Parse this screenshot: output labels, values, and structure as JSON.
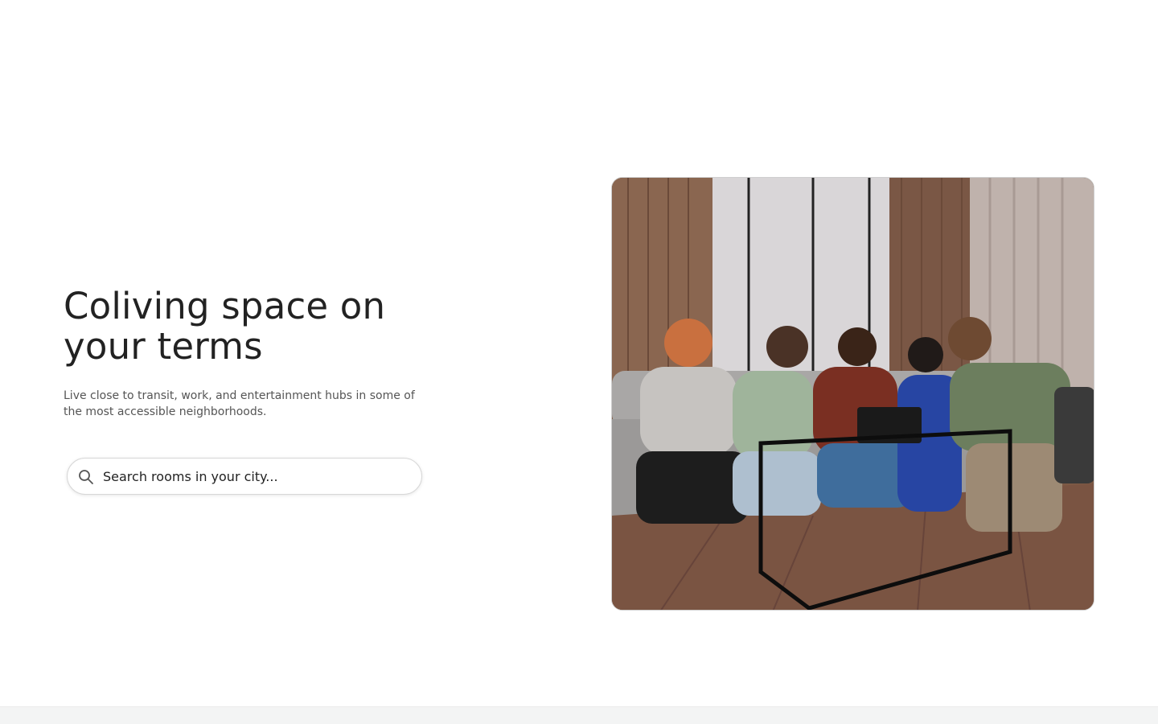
{
  "hero": {
    "title": "Coliving space on your terms",
    "subtitle": "Live close to transit, work, and entertainment hubs in some of the most accessible neighborhoods."
  },
  "search": {
    "placeholder": "Search rooms in your city...",
    "icon": "search-icon"
  },
  "colors": {
    "text": "#222222",
    "subtext": "#555555",
    "border": "#d7d7d7",
    "footer_bg": "#f3f4f4"
  }
}
